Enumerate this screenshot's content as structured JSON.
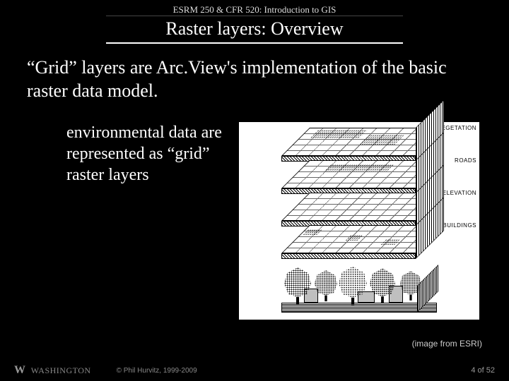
{
  "header": {
    "course": "ESRM 250 & CFR 520: Introduction to GIS",
    "title": "Raster layers: Overview"
  },
  "body": {
    "heading": "“Grid” layers are Arc.View's implementation of the basic raster data model.",
    "paragraph": "environmental data are represented as “grid” raster layers"
  },
  "figure": {
    "layers": [
      "VEGETATION",
      "ROADS",
      "ELEVATION",
      "BUILDINGS"
    ],
    "credit": "(image from ESRI)"
  },
  "footer": {
    "org": "WASHINGTON",
    "copyright": "© Phil Hurvitz, 1999-2009",
    "page": "4 of 52"
  }
}
